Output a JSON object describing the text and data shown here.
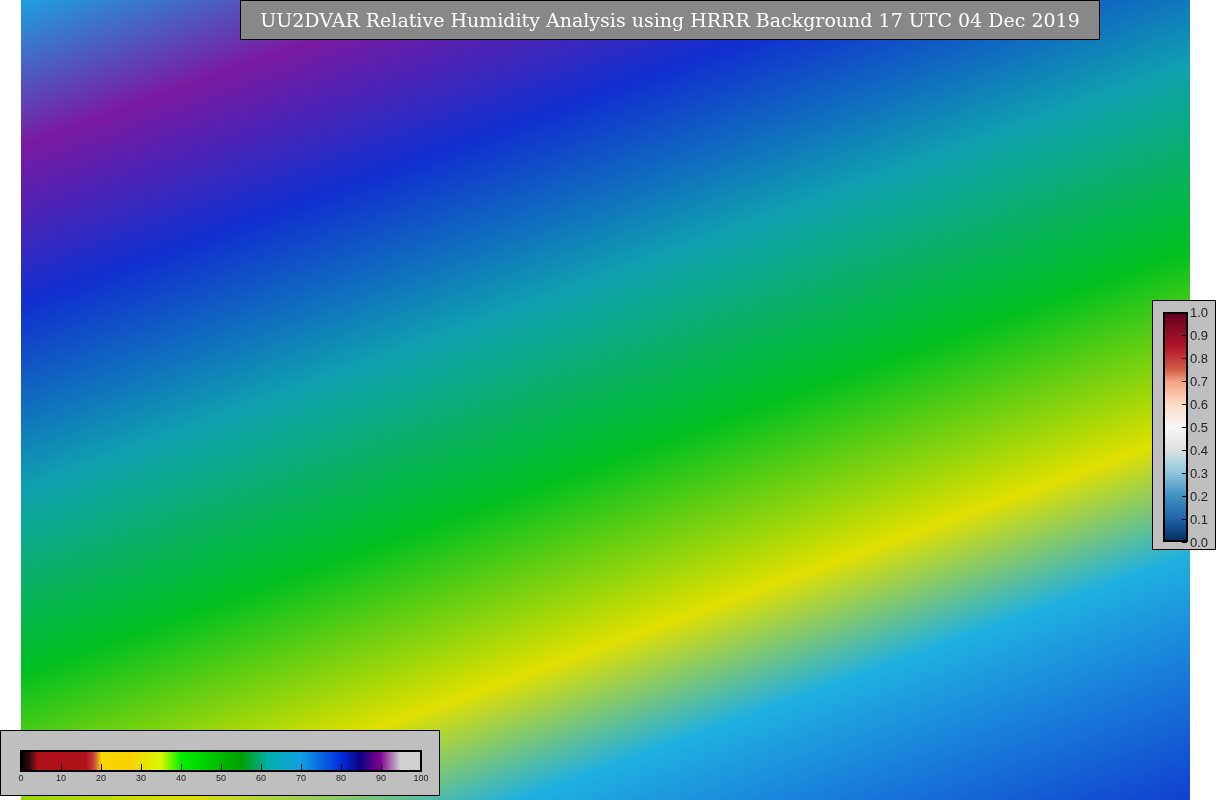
{
  "title": "UU2DVAR Relative Humidity Analysis using HRRR Background 17 UTC 04 Dec 2019",
  "humidity_colorbar": {
    "ticks": [
      "0",
      "10",
      "20",
      "30",
      "40",
      "50",
      "60",
      "70",
      "80",
      "90",
      "100"
    ]
  },
  "ratio_colorbar": {
    "ticks": [
      "1.0",
      "0.9",
      "0.8",
      "0.7",
      "0.6",
      "0.5",
      "0.4",
      "0.3",
      "0.2",
      "0.1",
      "0.0"
    ]
  }
}
